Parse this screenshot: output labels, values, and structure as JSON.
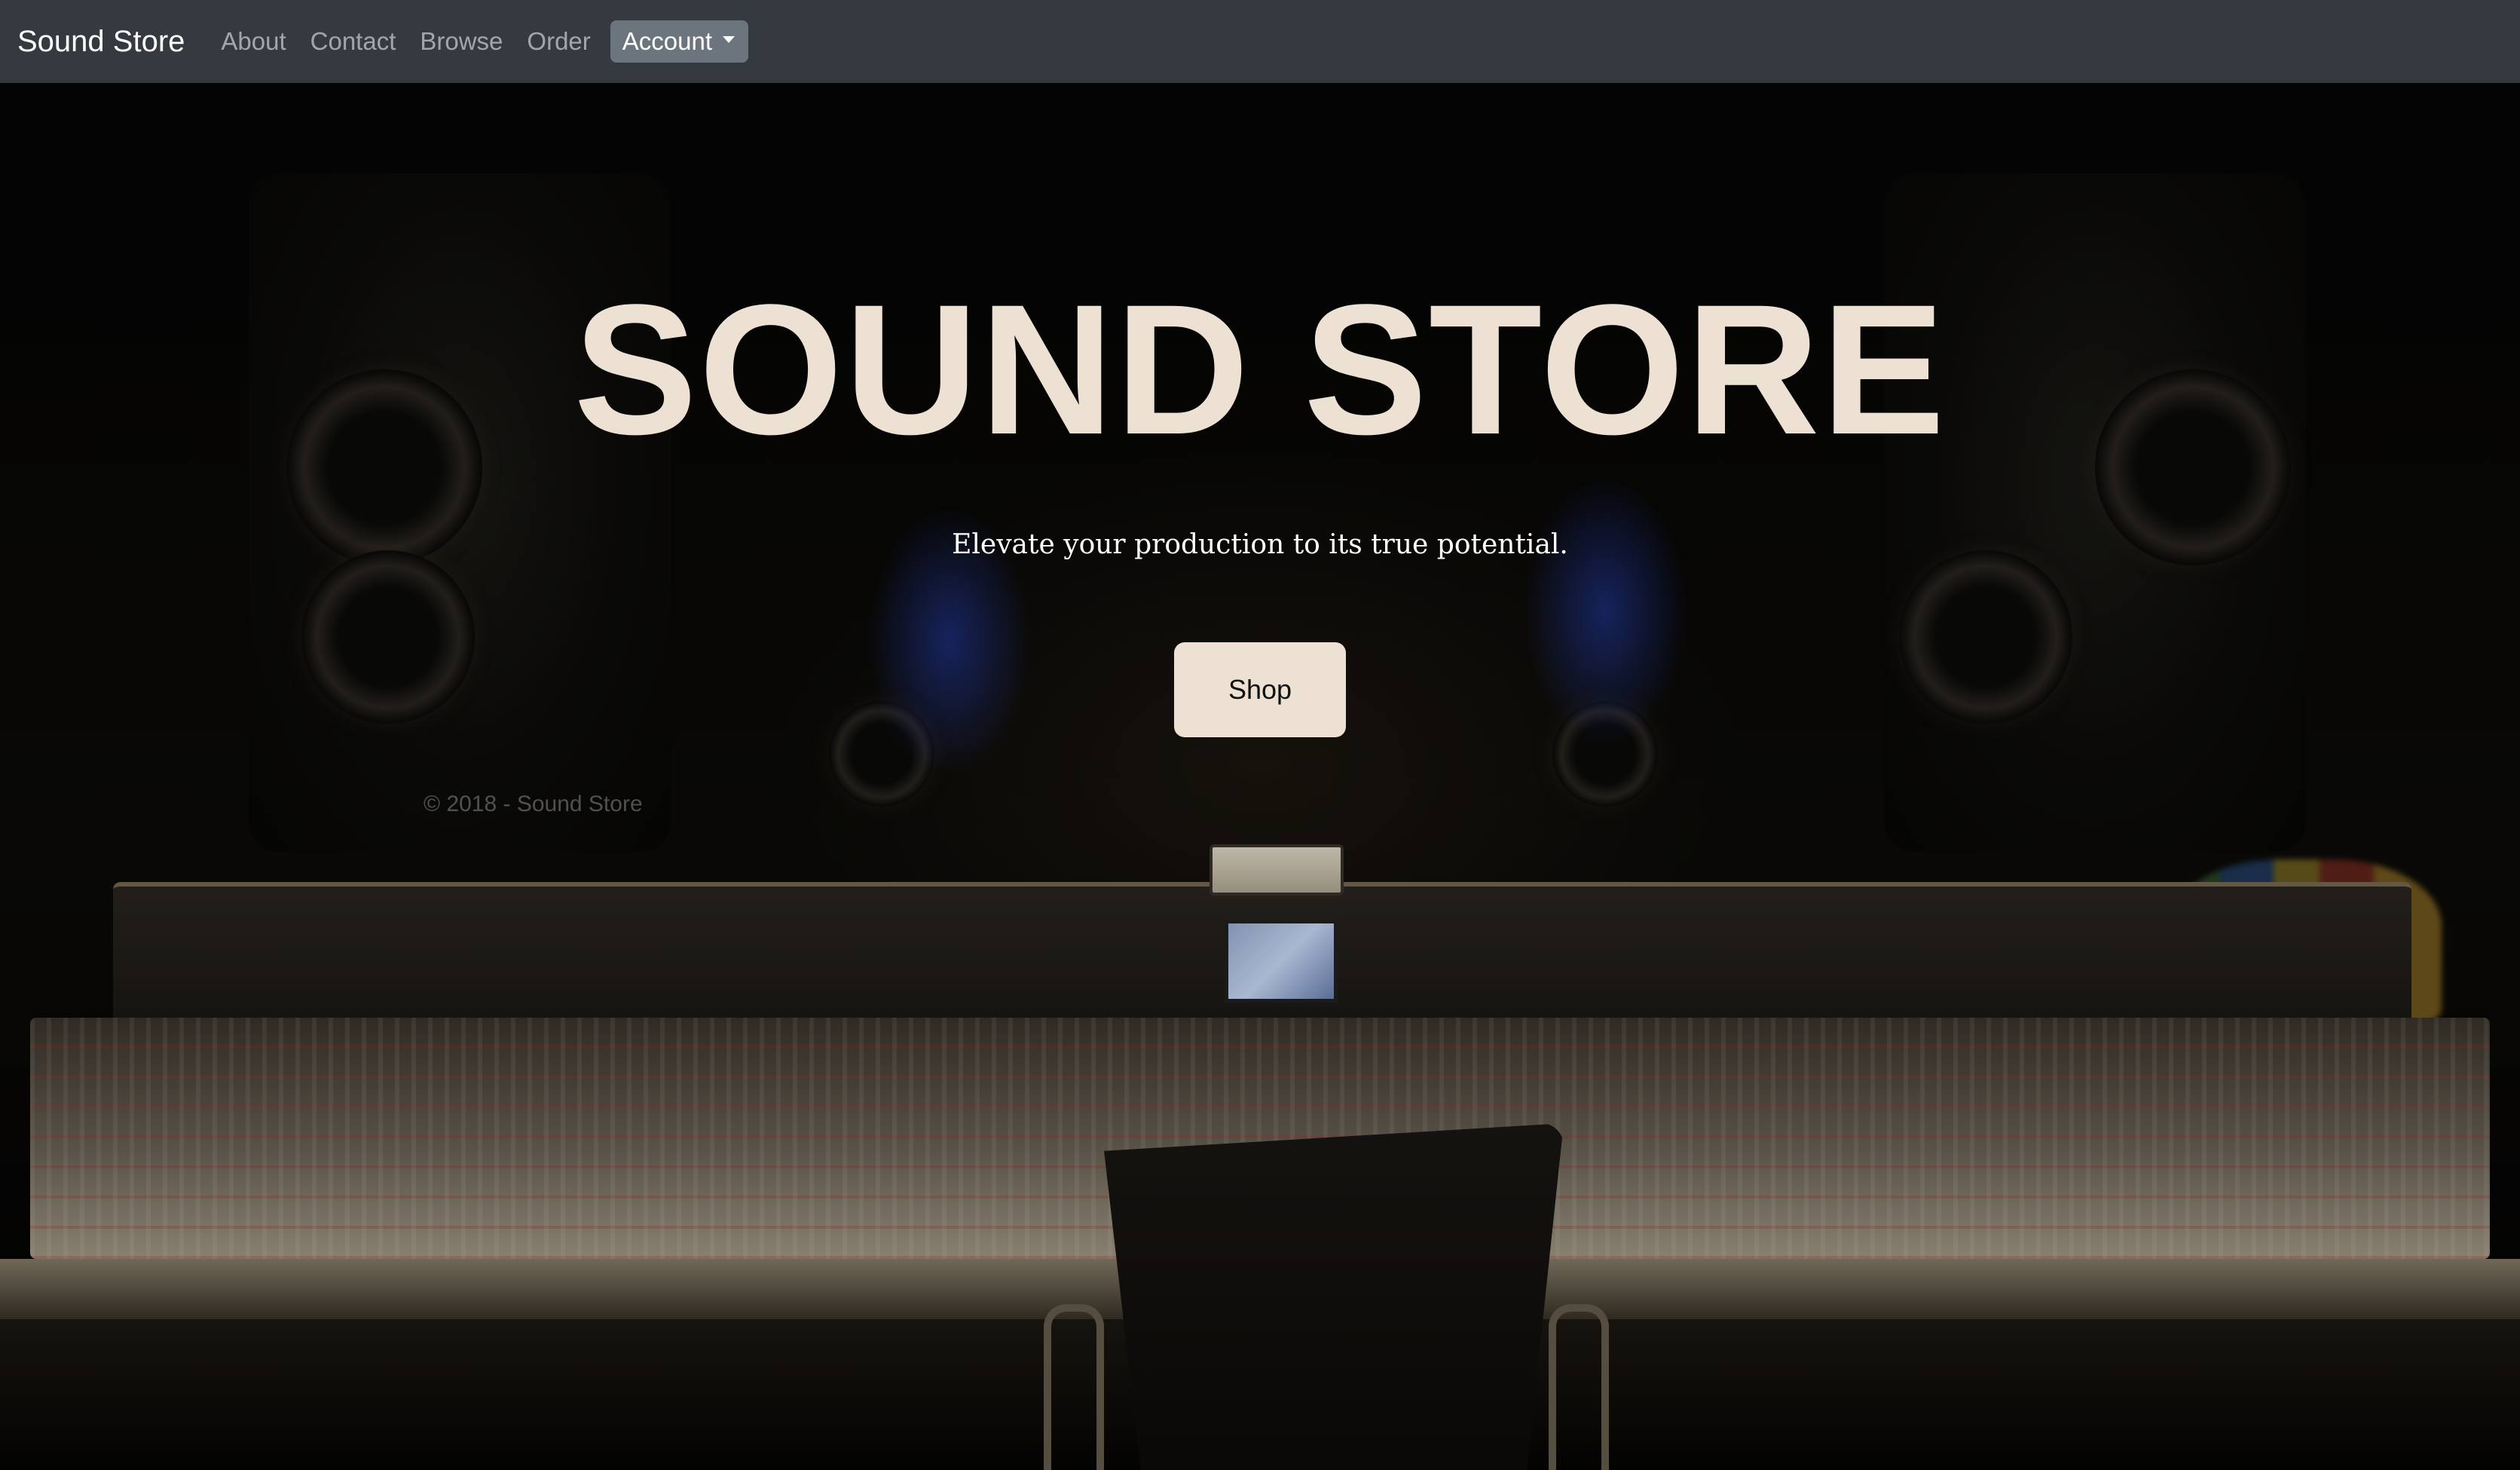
{
  "navbar": {
    "brand": "Sound Store",
    "links": [
      "About",
      "Contact",
      "Browse",
      "Order"
    ],
    "account_label": "Account"
  },
  "hero": {
    "title": "SOUND STORE",
    "subtitle": "Elevate your production to its true potential.",
    "shop_label": "Shop"
  },
  "footer": {
    "copyright": "© 2018 - Sound Store"
  },
  "colors": {
    "navbar_bg": "#343a40",
    "accent_cream": "#ece1d3",
    "dropdown_bg": "#6c757d"
  }
}
